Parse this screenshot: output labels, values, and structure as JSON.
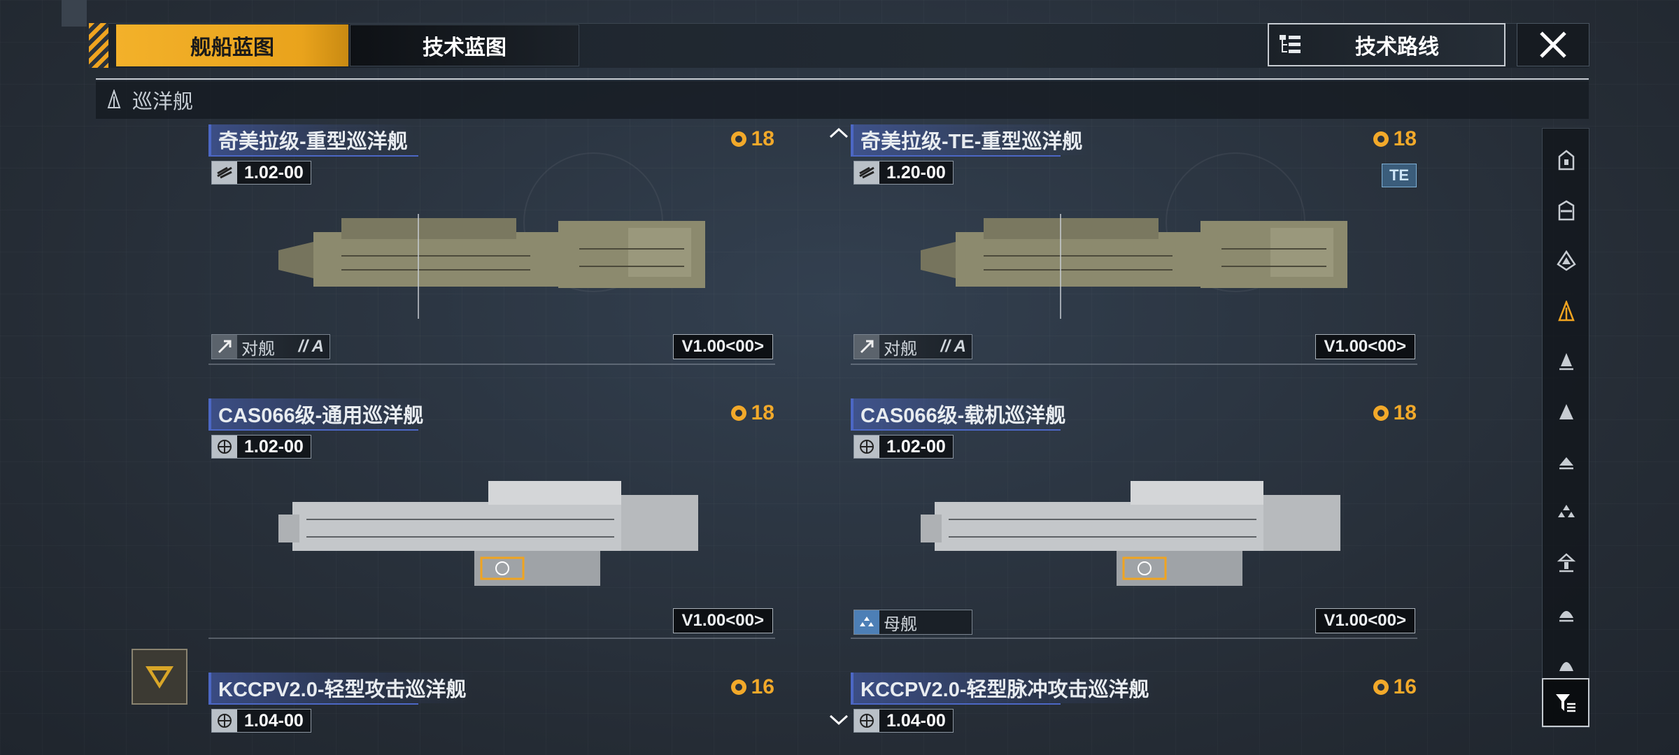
{
  "tabs": {
    "ship_blueprints": "舰船蓝图",
    "tech_blueprints": "技术蓝图"
  },
  "tech_route_label": "技术路线",
  "category": "巡洋舰",
  "cards": [
    {
      "title": "奇美拉级-重型巡洋舰",
      "cost": "18",
      "version": "1.02-00",
      "role": "对舰",
      "grade": "// A",
      "model_version": "V1.00<00>",
      "hull_color": "#8c8a6e"
    },
    {
      "title": "奇美拉级-TE-重型巡洋舰",
      "cost": "18",
      "version": "1.20-00",
      "badge": "TE",
      "role": "对舰",
      "grade": "// A",
      "model_version": "V1.00<00>",
      "hull_color": "#8c8a6e"
    },
    {
      "title": "CAS066级-通用巡洋舰",
      "cost": "18",
      "version": "1.02-00",
      "model_version": "V1.00<00>",
      "hull_color": "#c4c7ca"
    },
    {
      "title": "CAS066级-载机巡洋舰",
      "cost": "18",
      "version": "1.02-00",
      "role": "母舰",
      "model_version": "V1.00<00>",
      "hull_color": "#c4c7ca"
    },
    {
      "title": "KCCPV2.0-轻型攻击巡洋舰",
      "cost": "16",
      "version": "1.04-00"
    },
    {
      "title": "KCCPV2.0-轻型脉冲攻击巡洋舰",
      "cost": "16",
      "version": "1.04-00"
    }
  ],
  "colors": {
    "accent": "#f0a420",
    "title_bar": "#4c67c4",
    "cost": "#f2a92a"
  },
  "icons": {
    "close": "close-icon",
    "tech_route": "tree-list-icon",
    "category": "cruiser-icon",
    "cost": "gear-badge-icon",
    "filter": "filter-icon"
  }
}
